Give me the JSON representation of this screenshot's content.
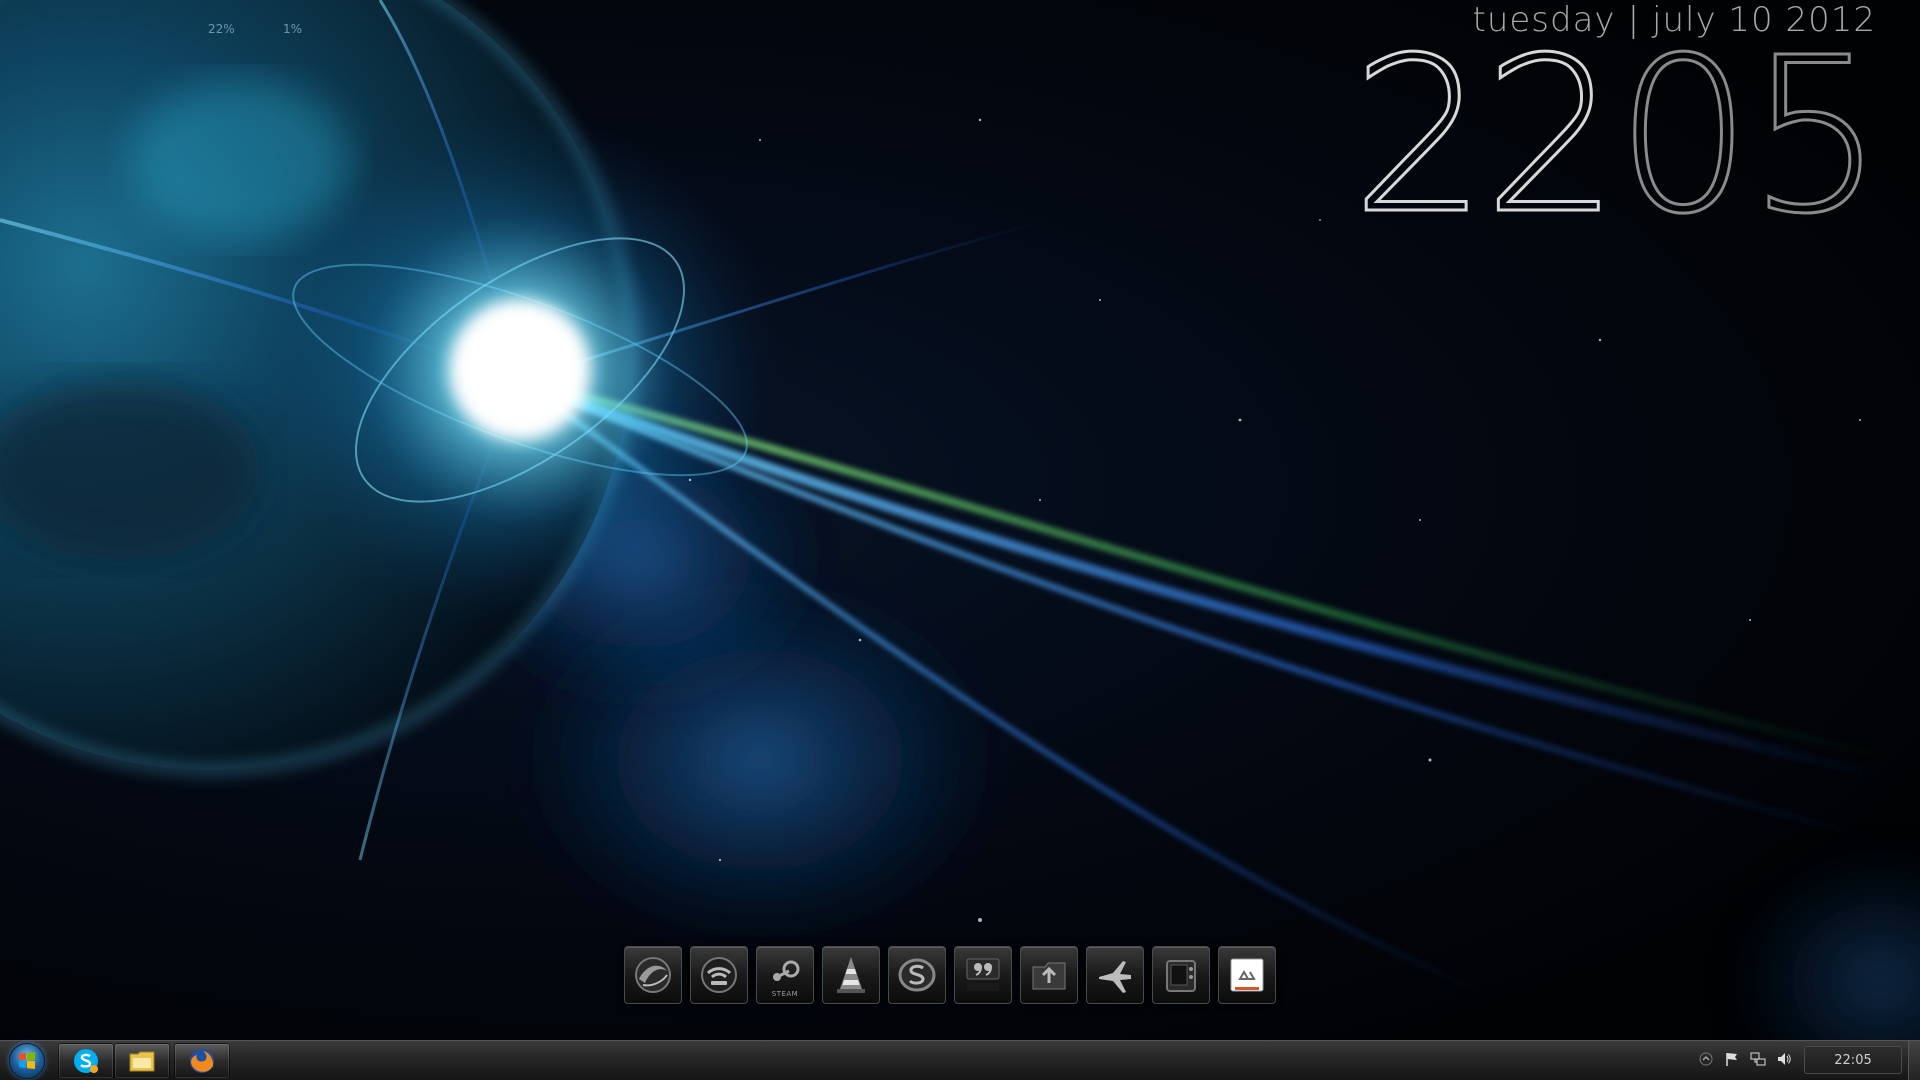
{
  "desktop": {
    "system_meters": {
      "cpu": "22%",
      "ram": "1%"
    },
    "date_gadget": {
      "day": "tuesday",
      "separator": "|",
      "date": "july 10 2012"
    },
    "clock_gadget": {
      "hours": "22",
      "minutes": "05"
    }
  },
  "dock": {
    "items": [
      {
        "name": "browser",
        "icon": "globe-swirl-icon"
      },
      {
        "name": "wireless",
        "icon": "wifi-icon"
      },
      {
        "name": "steam",
        "icon": "steam-icon",
        "label": "STEAM"
      },
      {
        "name": "vlc",
        "icon": "traffic-cone-icon"
      },
      {
        "name": "skype",
        "icon": "skype-icon"
      },
      {
        "name": "quotes",
        "icon": "quote-icon"
      },
      {
        "name": "upload",
        "icon": "upload-folder-icon"
      },
      {
        "name": "game",
        "icon": "fighter-jet-icon"
      },
      {
        "name": "device",
        "icon": "handheld-device-icon"
      },
      {
        "name": "recycle-bin",
        "icon": "recycle-bin-icon"
      }
    ]
  },
  "taskbar": {
    "start": {
      "icon": "windows-logo-icon"
    },
    "pinned": [
      {
        "name": "skype",
        "icon": "skype-icon"
      },
      {
        "name": "explorer",
        "icon": "folder-icon"
      },
      {
        "name": "firefox",
        "icon": "firefox-icon"
      }
    ],
    "tray": [
      {
        "name": "hidden-icons",
        "icon": "chevron-up-icon"
      },
      {
        "name": "action-center",
        "icon": "flag-icon"
      },
      {
        "name": "network",
        "icon": "network-icon"
      },
      {
        "name": "volume",
        "icon": "speaker-icon"
      }
    ],
    "clock": "22:05"
  },
  "colors": {
    "accent_blue": "#5fd6ff",
    "text_gray": "#a8a8a8",
    "taskbar_bg": "#262626"
  }
}
